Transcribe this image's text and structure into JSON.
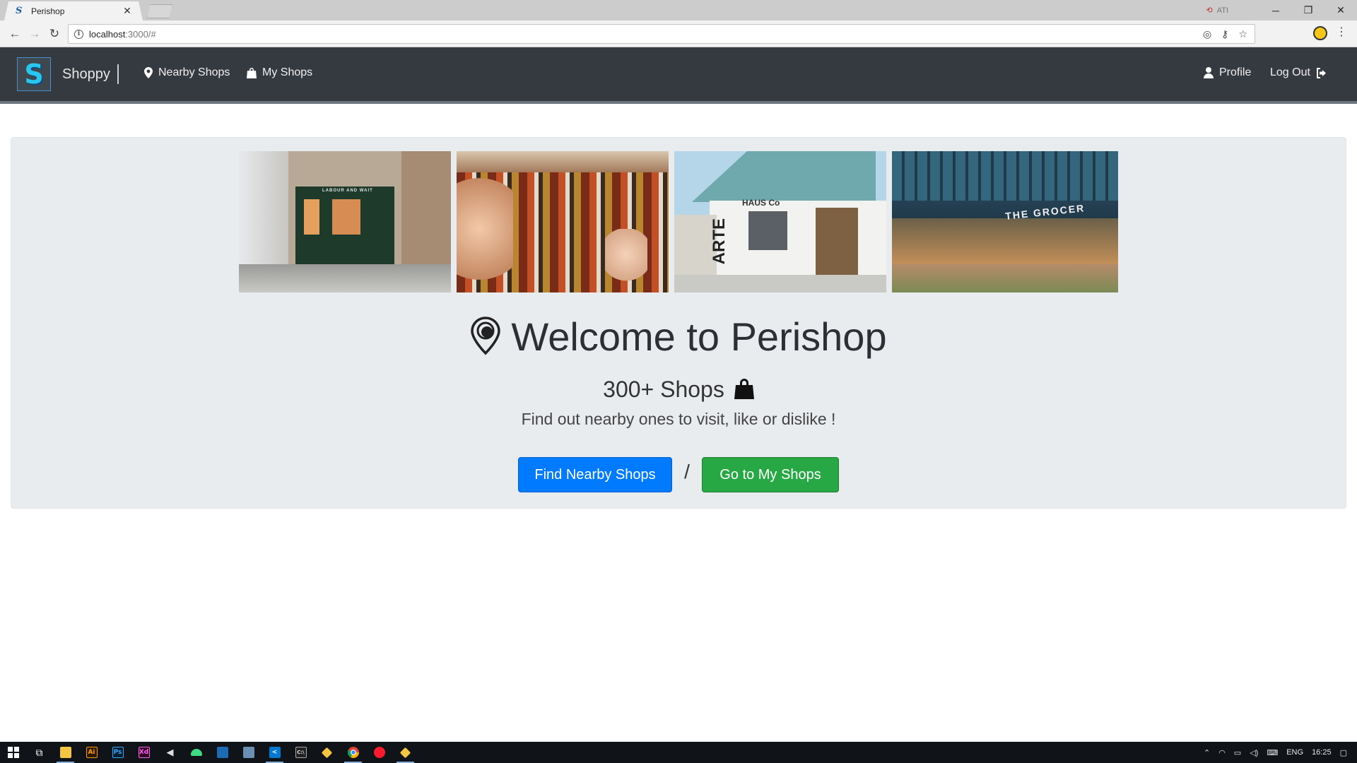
{
  "browser": {
    "tab_title": "Perishop",
    "tab_favicon": "S",
    "url_host": "localhost",
    "url_rest": ":3000/#",
    "close_glyph": "✕",
    "ext_label": "ATI"
  },
  "navbar": {
    "brand_logo_letter": "S",
    "brand_name": "Shoppy",
    "links": {
      "nearby": "Nearby Shops",
      "my": "My Shops",
      "profile": "Profile",
      "logout": "Log Out"
    }
  },
  "hero": {
    "title": "Welcome to Perishop",
    "subtitle": "300+ Shops",
    "description": "Find out nearby ones to visit, like or dislike !",
    "find_button": "Find Nearby Shops",
    "separator": "/",
    "myshops_button": "Go to My Shops"
  },
  "gallery": {
    "photo1_sign": "LABOUR AND WAIT",
    "photo3_sign_top": "HAUS Co",
    "photo3_sign_side": "ARTE",
    "photo4_sign": "THE GROCER"
  },
  "taskbar": {
    "lang": "ENG",
    "time": "16:25",
    "icons": [
      "windows-start-icon",
      "task-view-icon",
      "file-explorer-icon",
      "illustrator-icon",
      "photoshop-icon",
      "xd-icon",
      "winamp-icon",
      "android-studio-icon",
      "virtualbox-icon",
      "network-icon",
      "vscode-icon",
      "cmd-icon",
      "git-kraken-icon",
      "chrome-icon",
      "opera-icon",
      "sourcetree-icon"
    ]
  },
  "colors": {
    "navbar_bg": "#343a40",
    "jumbotron_bg": "#e9ecef",
    "primary": "#007bff",
    "success": "#28a745"
  }
}
